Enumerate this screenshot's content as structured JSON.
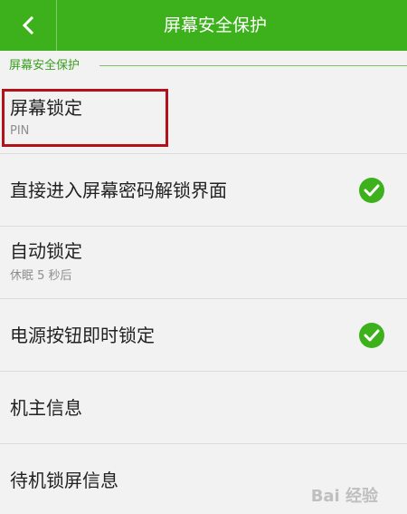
{
  "header": {
    "title": "屏幕安全保护",
    "back_icon": "chevron-left-icon"
  },
  "section": {
    "label": "屏幕安全保护"
  },
  "rows": [
    {
      "title": "屏幕锁定",
      "subtitle": "PIN"
    },
    {
      "title": "直接进入屏幕密码解锁界面",
      "checked": true
    },
    {
      "title": "自动锁定",
      "subtitle": "休眠 5 秒后"
    },
    {
      "title": "电源按钮即时锁定",
      "checked": true
    },
    {
      "title": "机主信息"
    },
    {
      "title": "待机锁屏信息"
    }
  ],
  "watermark": "Bai 经验",
  "colors": {
    "accent": "#3db11c",
    "highlight": "#b3121d"
  }
}
